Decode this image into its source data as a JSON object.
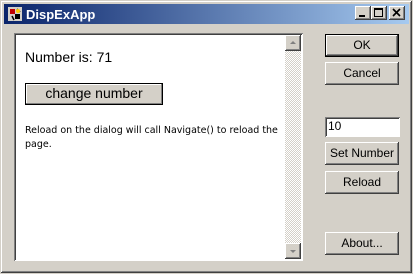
{
  "window": {
    "title": "DispExApp"
  },
  "titlebar": {
    "minimize_icon": "minimize-icon",
    "maximize_icon": "maximize-icon",
    "close_icon": "close-icon",
    "active_color": "#0a246a"
  },
  "browser": {
    "number_text": "Number is: 71",
    "change_button": "change number",
    "description": "Reload on the dialog will call Navigate() to reload the page."
  },
  "dialog": {
    "ok_label": "OK",
    "cancel_label": "Cancel",
    "number_value": "10",
    "set_number_label": "Set Number",
    "reload_label": "Reload",
    "about_label": "About..."
  }
}
